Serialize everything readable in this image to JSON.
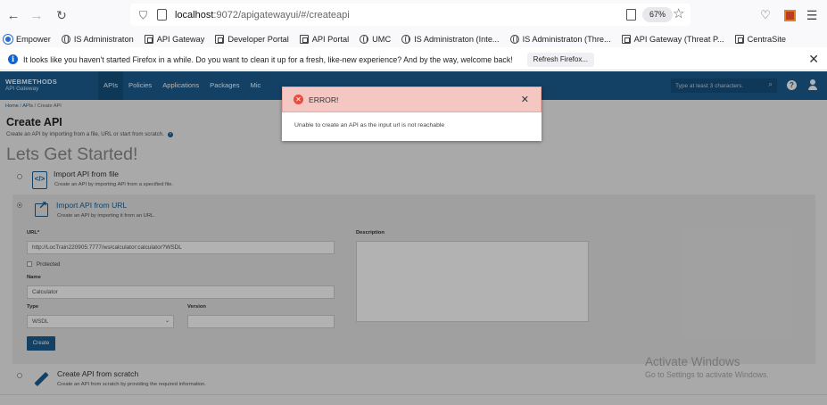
{
  "browser": {
    "url_host": "localhost",
    "url_rest": ":9072/apigatewayui/#/createapi",
    "zoom": "67%",
    "bookmarks": [
      {
        "label": "Empower",
        "icon": "emp"
      },
      {
        "label": "IS Administraton",
        "icon": "globe"
      },
      {
        "label": "API Gateway",
        "icon": "frame"
      },
      {
        "label": "Developer Portal",
        "icon": "frame"
      },
      {
        "label": "API Portal",
        "icon": "frame"
      },
      {
        "label": "UMC",
        "icon": "globe"
      },
      {
        "label": "IS Administraton (Inte...",
        "icon": "globe"
      },
      {
        "label": "IS Administraton (Thre...",
        "icon": "globe"
      },
      {
        "label": "API Gateway (Threat P...",
        "icon": "frame"
      },
      {
        "label": "CentraSite",
        "icon": "frame"
      }
    ],
    "notification": {
      "text": "It looks like you haven't started Firefox in a while. Do you want to clean it up for a fresh, like-new experience? And by the way, welcome back!",
      "button": "Refresh Firefox..."
    }
  },
  "app": {
    "brand_line1": "WEBMETHODS",
    "brand_line2": "API Gateway",
    "nav": [
      "APIs",
      "Policies",
      "Applications",
      "Packages",
      "Mic"
    ],
    "search_placeholder": "Type at least 3 characters.",
    "breadcrumb": {
      "home": "Home",
      "apis": "APIs",
      "current": "Create API"
    },
    "page_title": "Create API",
    "page_subtitle": "Create an API by importing from a file, URL or start from scratch.",
    "lets_started": "Lets Get Started!",
    "options": {
      "file": {
        "title": "Import API from file",
        "desc": "Create an API by importing API from a specified file."
      },
      "url": {
        "title": "Import API from URL",
        "desc": "Create an API by importing it from an URL."
      },
      "scratch": {
        "title": "Create API from scratch",
        "desc": "Create an API from scratch by providing the required information."
      }
    },
    "form": {
      "url_label": "URL*",
      "url_value": "http://LocTrain220905:7777/ws/calculator:calculator?WSDL",
      "protected_label": "Protected",
      "name_label": "Name",
      "name_value": "Calculator",
      "type_label": "Type",
      "type_value": "WSDL",
      "version_label": "Version",
      "version_value": "",
      "description_label": "Description",
      "create_button": "Create"
    }
  },
  "dialog": {
    "title": "ERROR!",
    "message": "Unable to create an API as the input url is not reachable"
  },
  "watermark": {
    "line1": "Activate Windows",
    "line2": "Go to Settings to activate Windows."
  }
}
